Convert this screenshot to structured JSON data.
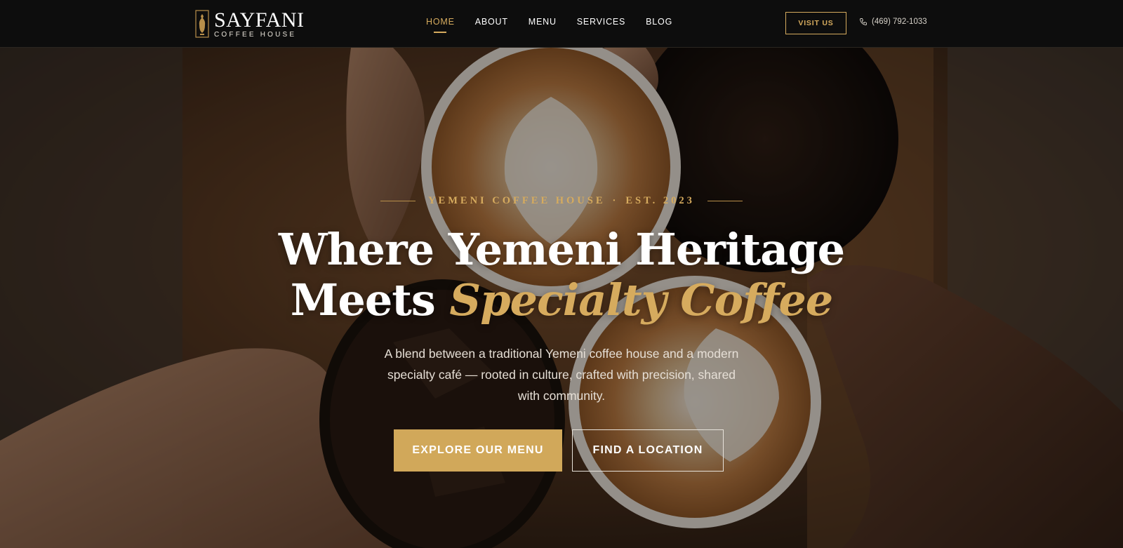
{
  "brand": {
    "name": "SAYFANI",
    "subtitle": "COFFEE HOUSE",
    "logo_icon": "coffee-pot-icon"
  },
  "nav": {
    "items": [
      {
        "label": "HOME",
        "active": true
      },
      {
        "label": "ABOUT",
        "active": false
      },
      {
        "label": "MENU",
        "active": false
      },
      {
        "label": "SERVICES",
        "active": false
      },
      {
        "label": "BLOG",
        "active": false
      }
    ],
    "visit_label": "VISIT US",
    "phone": "(469) 792-1033",
    "phone_icon": "phone-icon"
  },
  "hero": {
    "eyebrow_left": "YEMENI COFFEE HOUSE",
    "eyebrow_separator": "·",
    "eyebrow_right": "EST. 2023",
    "headline_line1": "Where Yemeni Heritage",
    "headline_line2_plain": "Meets ",
    "headline_line2_accent": "Specialty Coffee",
    "description": "A blend between a traditional Yemeni coffee house and a modern specialty café — rooted in culture, crafted with precision, shared with community.",
    "primary_cta": "EXPLORE OUR MENU",
    "secondary_cta": "FIND A LOCATION",
    "background_image": "coffee-cups-cheers-photo"
  },
  "colors": {
    "accent": "#d6ab5e",
    "nav_bg": "#0d0d0d",
    "primary_button": "#d1a85a"
  }
}
